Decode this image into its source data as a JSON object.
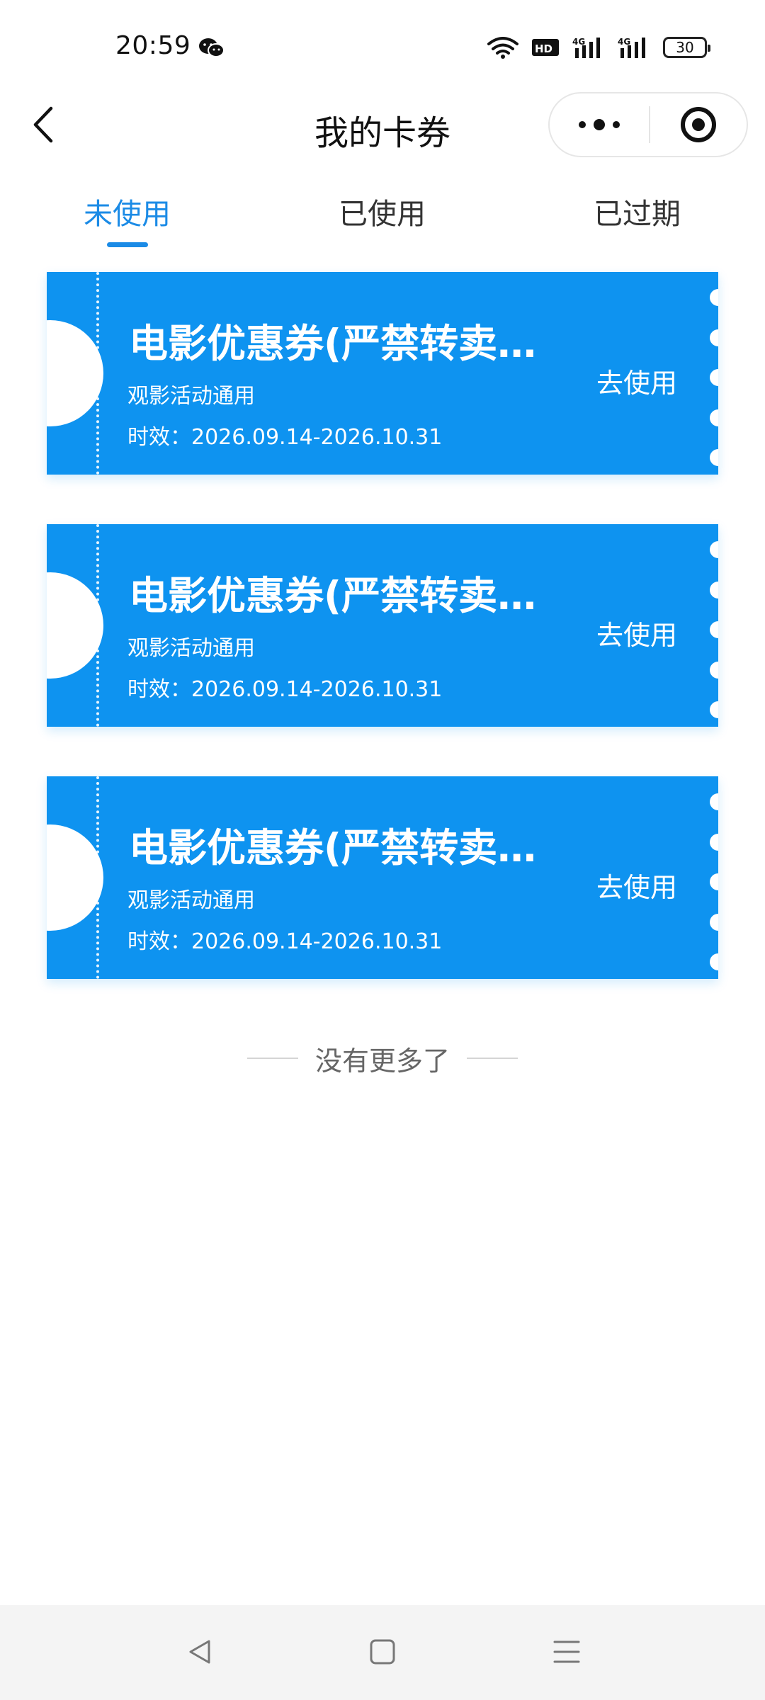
{
  "status_bar": {
    "time": "20:59",
    "battery": "30",
    "icons": [
      "wechat-icon",
      "wifi-icon",
      "hd-icon",
      "signal-4g-icon",
      "signal-4g-icon",
      "battery-icon"
    ]
  },
  "nav": {
    "title": "我的卡券",
    "back_icon": "chevron-left-icon",
    "more_icon": "more-dots-icon",
    "close_icon": "target-close-icon"
  },
  "tabs": [
    {
      "label": "未使用",
      "active": true
    },
    {
      "label": "已使用",
      "active": false
    },
    {
      "label": "已过期",
      "active": false
    }
  ],
  "coupons": [
    {
      "title": "电影优惠券(严禁转卖…",
      "subtitle": "观影活动通用",
      "validity": "时效：2026.09.14-2026.10.31",
      "action": "去使用"
    },
    {
      "title": "电影优惠券(严禁转卖…",
      "subtitle": "观影活动通用",
      "validity": "时效：2026.09.14-2026.10.31",
      "action": "去使用"
    },
    {
      "title": "电影优惠券(严禁转卖…",
      "subtitle": "观影活动通用",
      "validity": "时效：2026.09.14-2026.10.31",
      "action": "去使用"
    }
  ],
  "end_text": "没有更多了",
  "colors": {
    "accent": "#1b8be6",
    "coupon": "#0e93f0"
  }
}
